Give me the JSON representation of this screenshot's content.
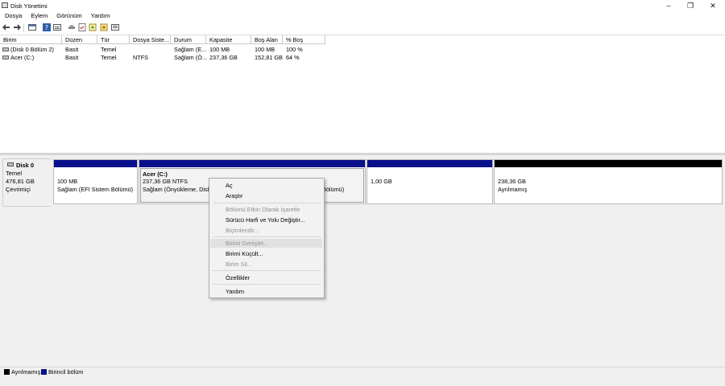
{
  "window": {
    "title": "Disk Yönetimi",
    "minimize": "–",
    "maximize": "❐",
    "close": "✕"
  },
  "menu": [
    "Dosya",
    "Eylem",
    "Görünüm",
    "Yardım"
  ],
  "toolbar": {
    "icons": [
      "back-icon",
      "forward-icon",
      "view-icon",
      "help-icon",
      "properties-icon",
      "connect-icon",
      "checklist-icon",
      "new-volume-icon",
      "settings-icon",
      "list-icon"
    ]
  },
  "volume_list": {
    "columns": [
      "Birim",
      "Düzen",
      "Tür",
      "Dosya Siste...",
      "Durum",
      "Kapasite",
      "Boş Alan",
      "% Boş"
    ],
    "rows": [
      [
        "(Disk 0 Bölüm 2)",
        "Basit",
        "Temel",
        "",
        "Sağlam (E...",
        "100 MB",
        "100 MB",
        "100 %"
      ],
      [
        "Acer (C:)",
        "Basit",
        "Temel",
        "NTFS",
        "Sağlam (Ö...",
        "237,36 GB",
        "152,81 GB",
        "64 %"
      ]
    ]
  },
  "disk": {
    "name": "Disk 0",
    "type": "Temel",
    "size": "476,81 GB",
    "status": "Çevrimiçi"
  },
  "partitions": {
    "efi": {
      "size": "100 MB",
      "status": "Sağlam (EFI Sistem Bölümü)"
    },
    "c": {
      "name": "Acer  (C:)",
      "size": "237,36 GB NTFS",
      "status_left": "Sağlam (Önyükleme, Disk",
      "status_right": "Bölümü)"
    },
    "p3": {
      "size": "1,00 GB"
    },
    "unalloc": {
      "size": "238,36 GB",
      "status": "Ayrılmamış"
    }
  },
  "context_menu": {
    "open": "Aç",
    "explore": "Araştır",
    "mark_active": "Bölümü Etkin Olarak İşaretle",
    "change_letter": "Sürücü Harfi ve Yolu Değiştir...",
    "format": "Biçimlendir...",
    "extend": "Birimi Genişlet...",
    "shrink": "Birimi Küçült...",
    "delete": "Birim Sil...",
    "properties": "Özellikler",
    "help": "Yardım"
  },
  "legend": {
    "unallocated": "Ayrılmamış",
    "primary": "Birincil bölüm",
    "unallocated_color": "#000000",
    "primary_color": "#0a0f8a"
  },
  "colors": {
    "partition_bar": "#0a0f8a",
    "unallocated_bar": "#000000"
  }
}
